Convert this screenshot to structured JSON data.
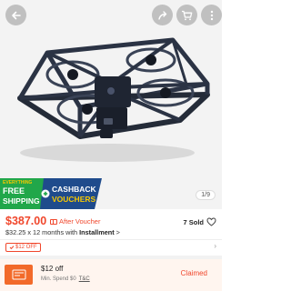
{
  "header": {
    "back_icon": "back-arrow-icon",
    "share_icon": "share-icon",
    "cart_icon": "cart-icon",
    "more_icon": "more-options-icon"
  },
  "hero": {
    "image": "drone-product-photo",
    "pager": "1/9"
  },
  "promo_banner": {
    "line1": "EVERYTHING",
    "line2": "FREE",
    "line3": "SHIPPING",
    "right_line1": "CASHBACK",
    "right_line2": "VOUCHERS",
    "colors": {
      "left": "#21a74a",
      "right": "#1f4b8c",
      "accent": "#f7c800"
    }
  },
  "product": {
    "price": "$387.00",
    "after_voucher": "After Voucher",
    "sold": "7 Sold",
    "installment_prefix": "$32.25 x 12 months with ",
    "installment_bold": "Installment",
    "installment_suffix": " >"
  },
  "voucher_tag": {
    "label": "$12 OFF"
  },
  "coupon": {
    "title": "$12 off",
    "subtitle": "Min. Spend $0",
    "terms": "T&C",
    "status": "Claimed",
    "accent": "#f0472c"
  }
}
